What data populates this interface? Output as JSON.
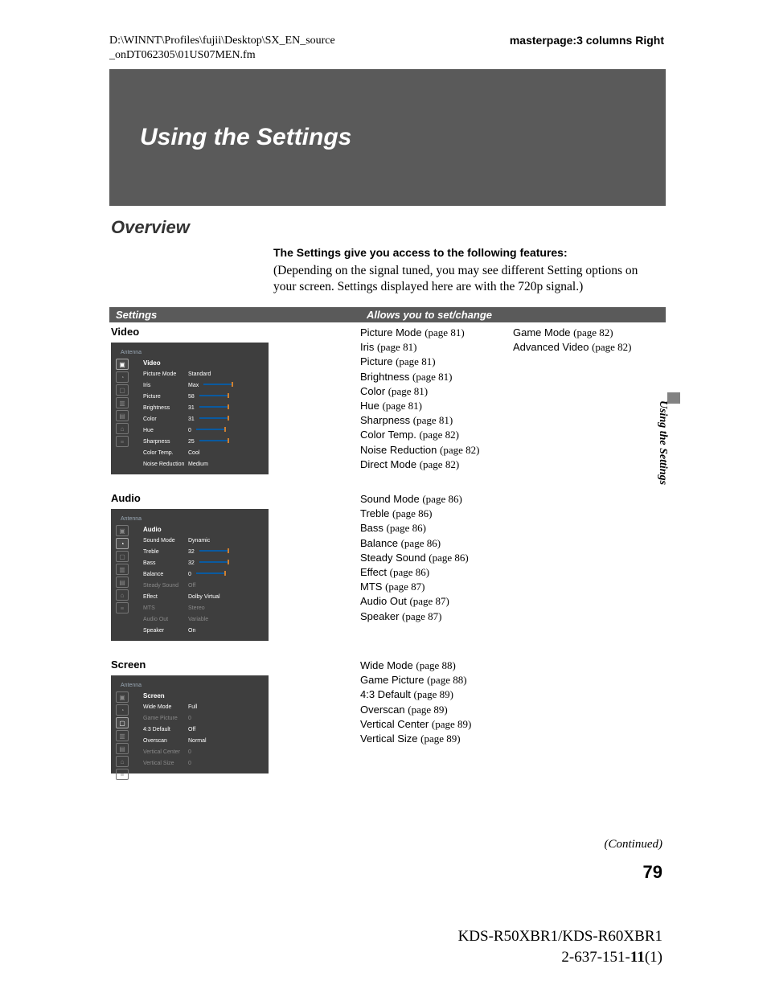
{
  "header": {
    "path_line1": "D:\\WINNT\\Profiles\\fujii\\Desktop\\SX_EN_source",
    "path_line2": "_onDT062305\\01US07MEN.fm",
    "masterpage": "masterpage:3 columns Right"
  },
  "chapter_title": "Using the Settings",
  "overview_heading": "Overview",
  "intro": {
    "lead": "The Settings give you access to the following features:",
    "body": "(Depending on the signal tuned, you may see different Setting options on your screen. Settings displayed here are with the 720p signal.)"
  },
  "table_head": {
    "col1": "Settings",
    "col2": "Allows you to set/change"
  },
  "categories": [
    {
      "name": "Video",
      "menu": {
        "header": "Antenna",
        "title": "Video",
        "rows": [
          {
            "label": "Picture Mode",
            "value": "Standard",
            "slider": false,
            "dim": false
          },
          {
            "label": "Iris",
            "value": "Max",
            "slider": true,
            "dim": false
          },
          {
            "label": "Picture",
            "value": "58",
            "slider": true,
            "dim": false
          },
          {
            "label": "Brightness",
            "value": "31",
            "slider": true,
            "dim": false
          },
          {
            "label": "Color",
            "value": "31",
            "slider": true,
            "dim": false
          },
          {
            "label": "Hue",
            "value": "0",
            "slider": true,
            "dim": false
          },
          {
            "label": "Sharpness",
            "value": "25",
            "slider": true,
            "dim": false
          },
          {
            "label": "Color Temp.",
            "value": "Cool",
            "slider": false,
            "dim": false
          },
          {
            "label": "Noise Reduction",
            "value": "Medium",
            "slider": false,
            "dim": false
          }
        ]
      },
      "features_col1": [
        {
          "name": "Picture Mode",
          "page": "(page 81)"
        },
        {
          "name": "Iris",
          "page": "(page 81)"
        },
        {
          "name": "Picture",
          "page": "(page 81)"
        },
        {
          "name": "Brightness",
          "page": "(page 81)"
        },
        {
          "name": "Color",
          "page": "(page 81)"
        },
        {
          "name": "Hue",
          "page": "(page 81)"
        },
        {
          "name": "Sharpness",
          "page": "(page 81)"
        },
        {
          "name": "Color Temp.",
          "page": "(page 82)"
        },
        {
          "name": "Noise Reduction",
          "page": "(page 82)"
        },
        {
          "name": "Direct Mode",
          "page": "(page 82)"
        }
      ],
      "features_col2": [
        {
          "name": "Game Mode",
          "page": "(page 82)"
        },
        {
          "name": "Advanced Video",
          "page": "(page 82)"
        }
      ]
    },
    {
      "name": "Audio",
      "menu": {
        "header": "Antenna",
        "title": "Audio",
        "rows": [
          {
            "label": "Sound Mode",
            "value": "Dynamic",
            "slider": false,
            "dim": false
          },
          {
            "label": "Treble",
            "value": "32",
            "slider": true,
            "dim": false
          },
          {
            "label": "Bass",
            "value": "32",
            "slider": true,
            "dim": false
          },
          {
            "label": "Balance",
            "value": "0",
            "slider": true,
            "dim": false
          },
          {
            "label": "Steady Sound",
            "value": "Off",
            "slider": false,
            "dim": true
          },
          {
            "label": "Effect",
            "value": "Dolby Virtual",
            "slider": false,
            "dim": false
          },
          {
            "label": "MTS",
            "value": "Stereo",
            "slider": false,
            "dim": true
          },
          {
            "label": "Audio Out",
            "value": "Variable",
            "slider": false,
            "dim": true
          },
          {
            "label": "Speaker",
            "value": "On",
            "slider": false,
            "dim": false
          }
        ]
      },
      "features_col1": [
        {
          "name": "Sound Mode",
          "page": "(page 86)"
        },
        {
          "name": "Treble",
          "page": "(page 86)"
        },
        {
          "name": "Bass",
          "page": "(page 86)"
        },
        {
          "name": "Balance",
          "page": "(page 86)"
        },
        {
          "name": "Steady Sound",
          "page": "(page 86)"
        },
        {
          "name": "Effect",
          "page": "(page 86)"
        },
        {
          "name": "MTS",
          "page": "(page 87)"
        },
        {
          "name": "Audio Out",
          "page": "(page 87)"
        },
        {
          "name": "Speaker",
          "page": "(page 87)"
        }
      ],
      "features_col2": []
    },
    {
      "name": "Screen",
      "menu": {
        "header": "Antenna",
        "title": "Screen",
        "rows": [
          {
            "label": "Wide Mode",
            "value": "Full",
            "slider": false,
            "dim": false
          },
          {
            "label": "Game Picture",
            "value": "0",
            "slider": false,
            "dim": true
          },
          {
            "label": "4:3 Default",
            "value": "Off",
            "slider": false,
            "dim": false
          },
          {
            "label": "Overscan",
            "value": "Normal",
            "slider": false,
            "dim": false
          },
          {
            "label": "Vertical Center",
            "value": "0",
            "slider": false,
            "dim": true
          },
          {
            "label": "Vertical Size",
            "value": "0",
            "slider": false,
            "dim": true
          }
        ]
      },
      "features_col1": [
        {
          "name": "Wide Mode",
          "page": "(page 88)"
        },
        {
          "name": "Game Picture",
          "page": "(page 88)"
        },
        {
          "name": "4:3 Default",
          "page": "(page 89)"
        },
        {
          "name": "Overscan",
          "page": "(page 89)"
        },
        {
          "name": "Vertical Center",
          "page": "(page 89)"
        },
        {
          "name": "Vertical Size",
          "page": "(page 89)"
        }
      ],
      "features_col2": []
    }
  ],
  "side_label": "Using the Settings",
  "continued": "(Continued)",
  "page_number": "79",
  "footer": {
    "models": "KDS-R50XBR1/KDS-R60XBR1",
    "code_prefix": "2-637-151-",
    "code_bold": "11",
    "code_suffix": "(1)"
  },
  "icons": [
    "▣",
    "◔",
    "▢",
    "▥",
    "▤",
    "⌂",
    "≡"
  ]
}
